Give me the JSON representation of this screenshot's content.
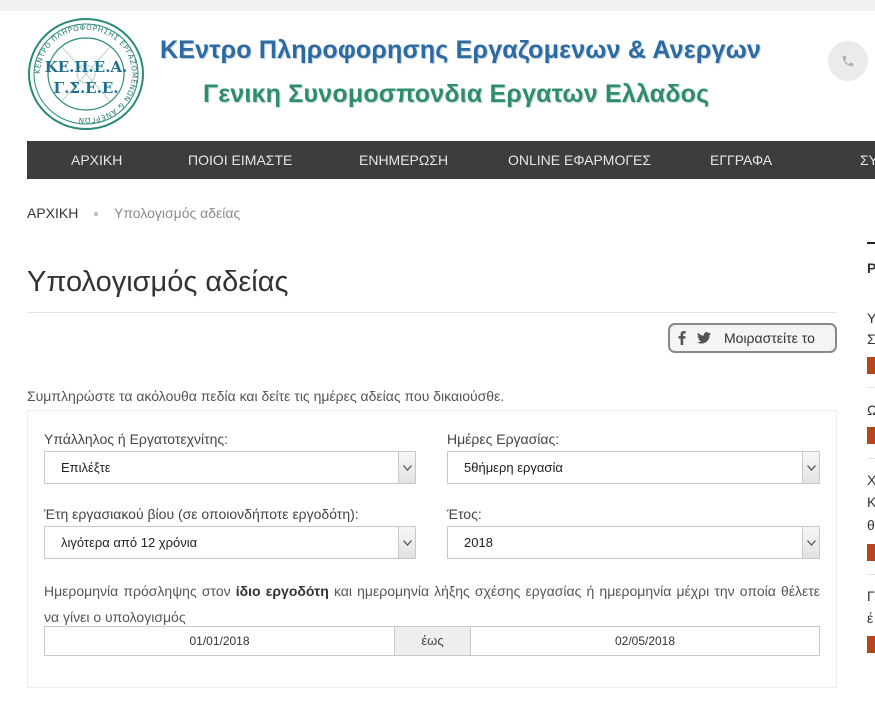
{
  "header": {
    "seal_text_main": "ΚΕ.Π.Ε.Α. Γ.Σ.Ε.Ε.",
    "seal_ring_text": "ΚΕΝΤΡΟ ΠΛΗΡΟΦΟΡΗΣΗΣ ΕΡΓΑΖΟΜΕΝΩΝ & ΑΝΕΡΓΩΝ",
    "brand_line_1": "ΚΕντρο Πληροφορησης Εργαζομενων & Ανεργων",
    "brand_line_2": "Γενικη Συνομοσπονδια Εργατων Ελλαδος",
    "brand_color_1": "#2b6aa2",
    "brand_color_2": "#2f8d6a",
    "phone_icon": "phone-icon"
  },
  "nav": {
    "items": [
      {
        "label": "ΑΡΧΙΚΗ"
      },
      {
        "label": "ΠΟΙΟΙ ΕΙΜΑΣΤΕ"
      },
      {
        "label": "ΕΝΗΜΕΡΩΣΗ"
      },
      {
        "label": "ONLINE ΕΦΑΡΜΟΓΕΣ"
      },
      {
        "label": "ΕΓΓΡΑΦΑ"
      },
      {
        "label": "ΣΥ"
      }
    ]
  },
  "breadcrumb": {
    "home": "ΑΡΧΙΚΗ",
    "current": "Υπολογισμός αδείας"
  },
  "page": {
    "title": "Υπολογισμός αδείας",
    "share_label": "Μοιραστείτε το",
    "intro": "Συμπληρώστε τα ακόλουθα πεδία και δείτε τις ημέρες αδείας που δικαιούσθε."
  },
  "form": {
    "employee_type": {
      "label": "Υπάλληλος ή Εργατοτεχνίτης:",
      "value": "Επιλέξτε"
    },
    "work_days": {
      "label": "Ημέρες Εργασίας:",
      "value": "5θήμερη εργασία"
    },
    "years_of_service": {
      "label": "Έτη εργασιακού βίου (σε οποιονδήποτε εργοδότη):",
      "value": "λιγότερα από 12 χρόνια"
    },
    "year": {
      "label": "Έτος:",
      "value": "2018"
    },
    "date_text_1": "Ημερομηνία πρόσληψης στον ",
    "date_text_bold": "ίδιο εργοδότη",
    "date_text_2": " και ημερομηνία λήξης σχέσης εργασίας ή ημερομηνία μέχρι την οποία θέλετε να γίνει ο υπολογισμός",
    "date_from": "01/01/2018",
    "date_sep": "έως",
    "date_to": "02/05/2018"
  },
  "sidebar_fragment": {
    "letters": [
      "Ρ",
      "Υ",
      "Σ",
      "Ω",
      "Χ",
      "Κ",
      "θ",
      "Γ",
      "έ"
    ],
    "tag_color": "#b5451b"
  }
}
